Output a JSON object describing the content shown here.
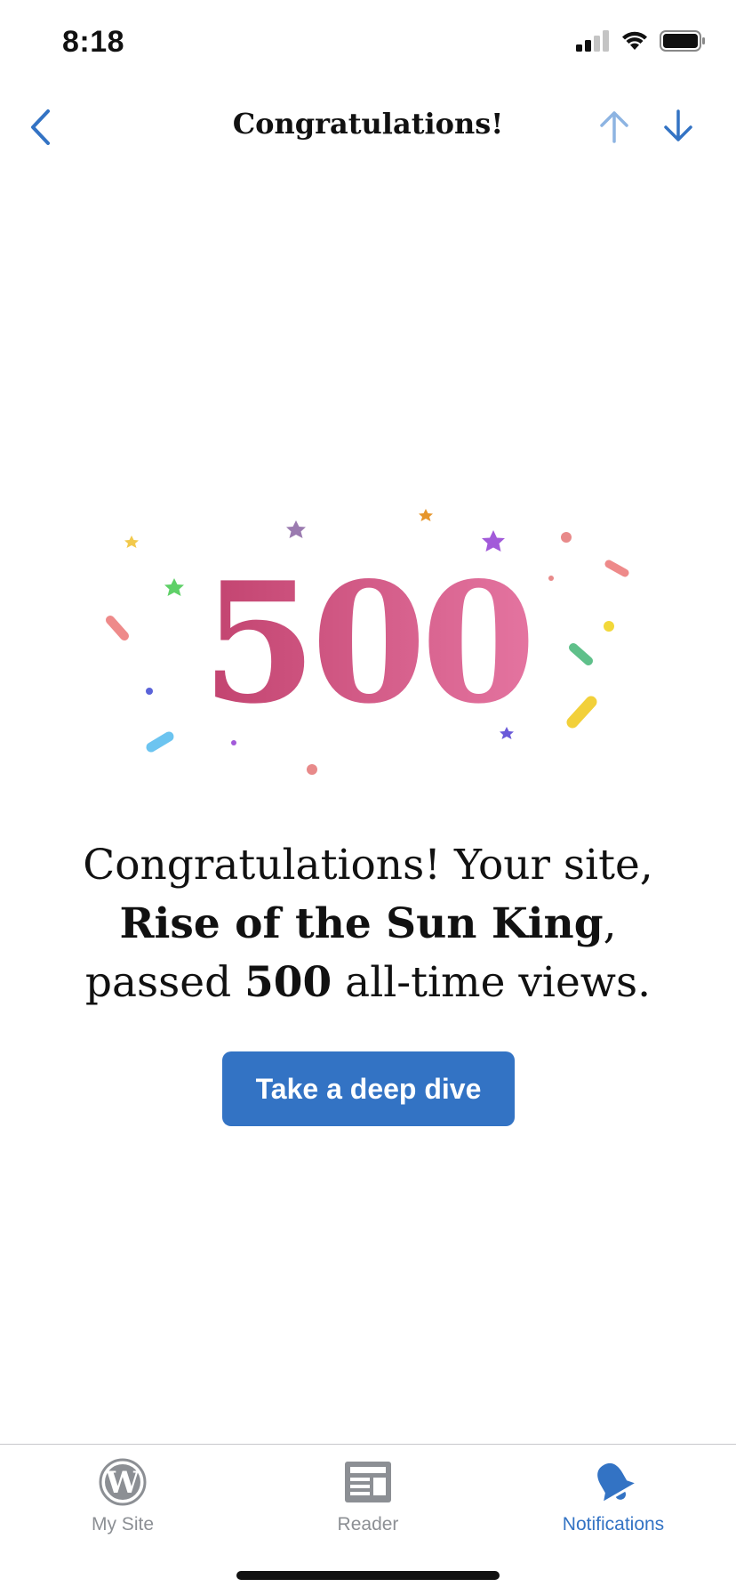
{
  "status_bar": {
    "time": "8:18",
    "icons": [
      "signal-icon",
      "wifi-icon",
      "battery-icon"
    ]
  },
  "nav": {
    "title": "Congratulations!",
    "back_icon": "chevron-left-icon",
    "previous_icon": "arrow-up-icon",
    "next_icon": "arrow-down-icon"
  },
  "milestone": {
    "number": "500"
  },
  "message": {
    "line1": "Congratulations! Your site,",
    "site_name": "Rise of the Sun King",
    "comma": ",",
    "passed": "passed",
    "count": "500",
    "suffix": "all-time views."
  },
  "cta": {
    "label": "Take a deep dive"
  },
  "tab_bar": {
    "tabs": [
      {
        "label": "My Site",
        "icon": "wordpress-icon",
        "active": false
      },
      {
        "label": "Reader",
        "icon": "reader-icon",
        "active": false
      },
      {
        "label": "Notifications",
        "icon": "bell-icon",
        "active": true
      }
    ]
  },
  "colors": {
    "accent": "#3373c4",
    "accent_light": "#8db4e2",
    "inactive": "#8c8f94",
    "milestone_gradient_start": "#c2436f",
    "milestone_gradient_end": "#e474a0"
  }
}
